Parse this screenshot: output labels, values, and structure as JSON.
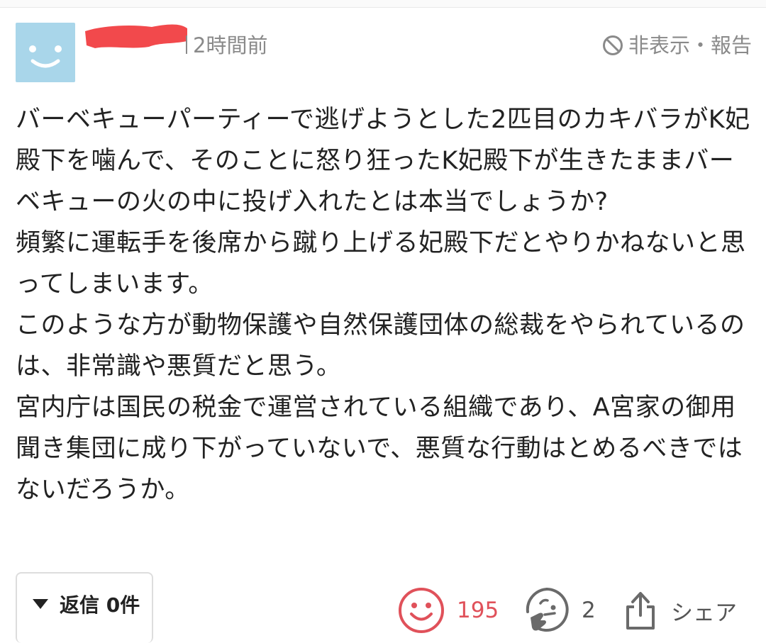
{
  "comment": {
    "time_ago": "2時間前",
    "hide_report_label": "非表示・報告",
    "paragraphs": [
      "バーベキューパーティーで逃げようとした2匹目のカキバラがK妃殿下を噛んで、そのことに怒り狂ったK妃殿下が生きたままバーベキューの火の中に投げ入れたとは本当でしょうか?",
      "頻繁に運転手を後席から蹴り上げる妃殿下だとやりかねないと思ってしまいます。",
      "このような方が動物保護や自然保護団体の総裁をやられているのは、非常識や悪質だと思う。",
      "宮内庁は国民の税金で運営されている組織であり、A宮家の御用聞き集団に成り下がっていないで、悪質な行動はとめるべきではないだろうか。"
    ]
  },
  "actions": {
    "reply_label": "返信",
    "reply_count": "0件",
    "like_count": "195",
    "think_count": "2",
    "share_label": "シェア"
  },
  "icons": {
    "avatar": "smiley-avatar-icon",
    "hide": "no-entry-icon",
    "like": "smile-face-icon",
    "think": "thinking-face-icon",
    "share": "share-upload-icon",
    "reply_toggle": "triangle-down-icon"
  },
  "colors": {
    "avatar_bg": "#a9d6ea",
    "like": "#e0515a",
    "redaction": "#f2494c",
    "meta": "#8a8a8a"
  }
}
